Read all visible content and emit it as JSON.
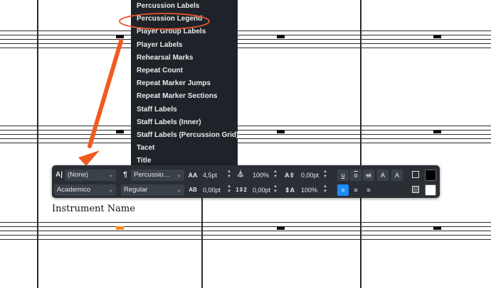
{
  "dropdown": {
    "items": [
      "Percussion Labels",
      "Percussion Legend",
      "Player Group Labels",
      "Player Labels",
      "Rehearsal Marks",
      "Repeat Count",
      "Repeat Marker Jumps",
      "Repeat Marker Sections",
      "Staff Labels",
      "Staff Labels (Inner)",
      "Staff Labels (Percussion Grid)",
      "Tacet",
      "Title"
    ],
    "highlighted": "Percussion Legend"
  },
  "annotation": {
    "arrow_color": "#f25a22",
    "circle_color": "#e8552a"
  },
  "toolbar": {
    "character_style": "(None)",
    "paragraph_style": "Percussio…",
    "font_family": "Academico",
    "font_style": "Regular",
    "font_size": "4,5pt",
    "char_spacing": "0,00pt",
    "width_scale": "100%",
    "line_spacing": "0,00pt",
    "baseline_offset": "0,00pt",
    "height_scale": "100%",
    "underline": "u",
    "overline": "o",
    "strikethrough": "st",
    "superscript": "A",
    "subscript": "A",
    "accent_color": "#1a8cff"
  },
  "score": {
    "text_label": "Instrument Name",
    "selected_color": "#f28c28"
  }
}
